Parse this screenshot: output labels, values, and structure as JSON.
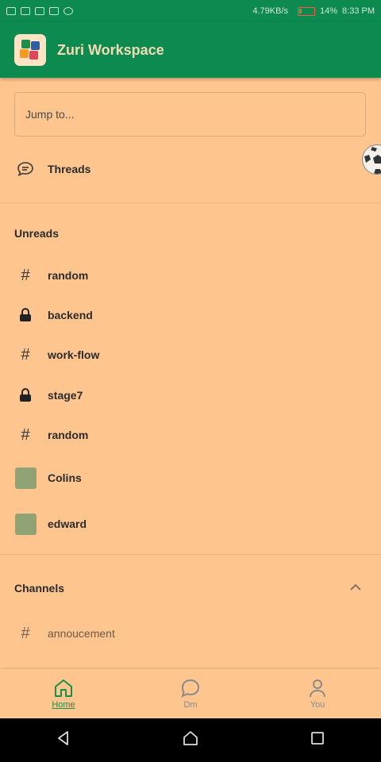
{
  "status_bar": {
    "speed": "4.79KB/s",
    "battery": "14%",
    "time": "8:33 PM"
  },
  "app": {
    "title": "Zuri Workspace"
  },
  "search": {
    "placeholder": "Jump to..."
  },
  "threads": {
    "label": "Threads"
  },
  "unreads": {
    "label": "Unreads",
    "items": [
      {
        "type": "hash",
        "label": "random"
      },
      {
        "type": "lock",
        "label": "backend"
      },
      {
        "type": "hash",
        "label": "work-flow"
      },
      {
        "type": "lock",
        "label": "stage7"
      },
      {
        "type": "hash",
        "label": "random"
      },
      {
        "type": "avatar",
        "label": "Colins"
      },
      {
        "type": "avatar",
        "label": "edward"
      }
    ]
  },
  "channels": {
    "label": "Channels",
    "items": [
      {
        "type": "hash",
        "label": "annoucement"
      }
    ]
  },
  "bottom_nav": {
    "home": "Home",
    "dm": "Dm",
    "you": "You"
  },
  "colors": {
    "primary": "#0c8a4f",
    "background": "#fec58f",
    "active_nav": "#1a8f4a"
  }
}
